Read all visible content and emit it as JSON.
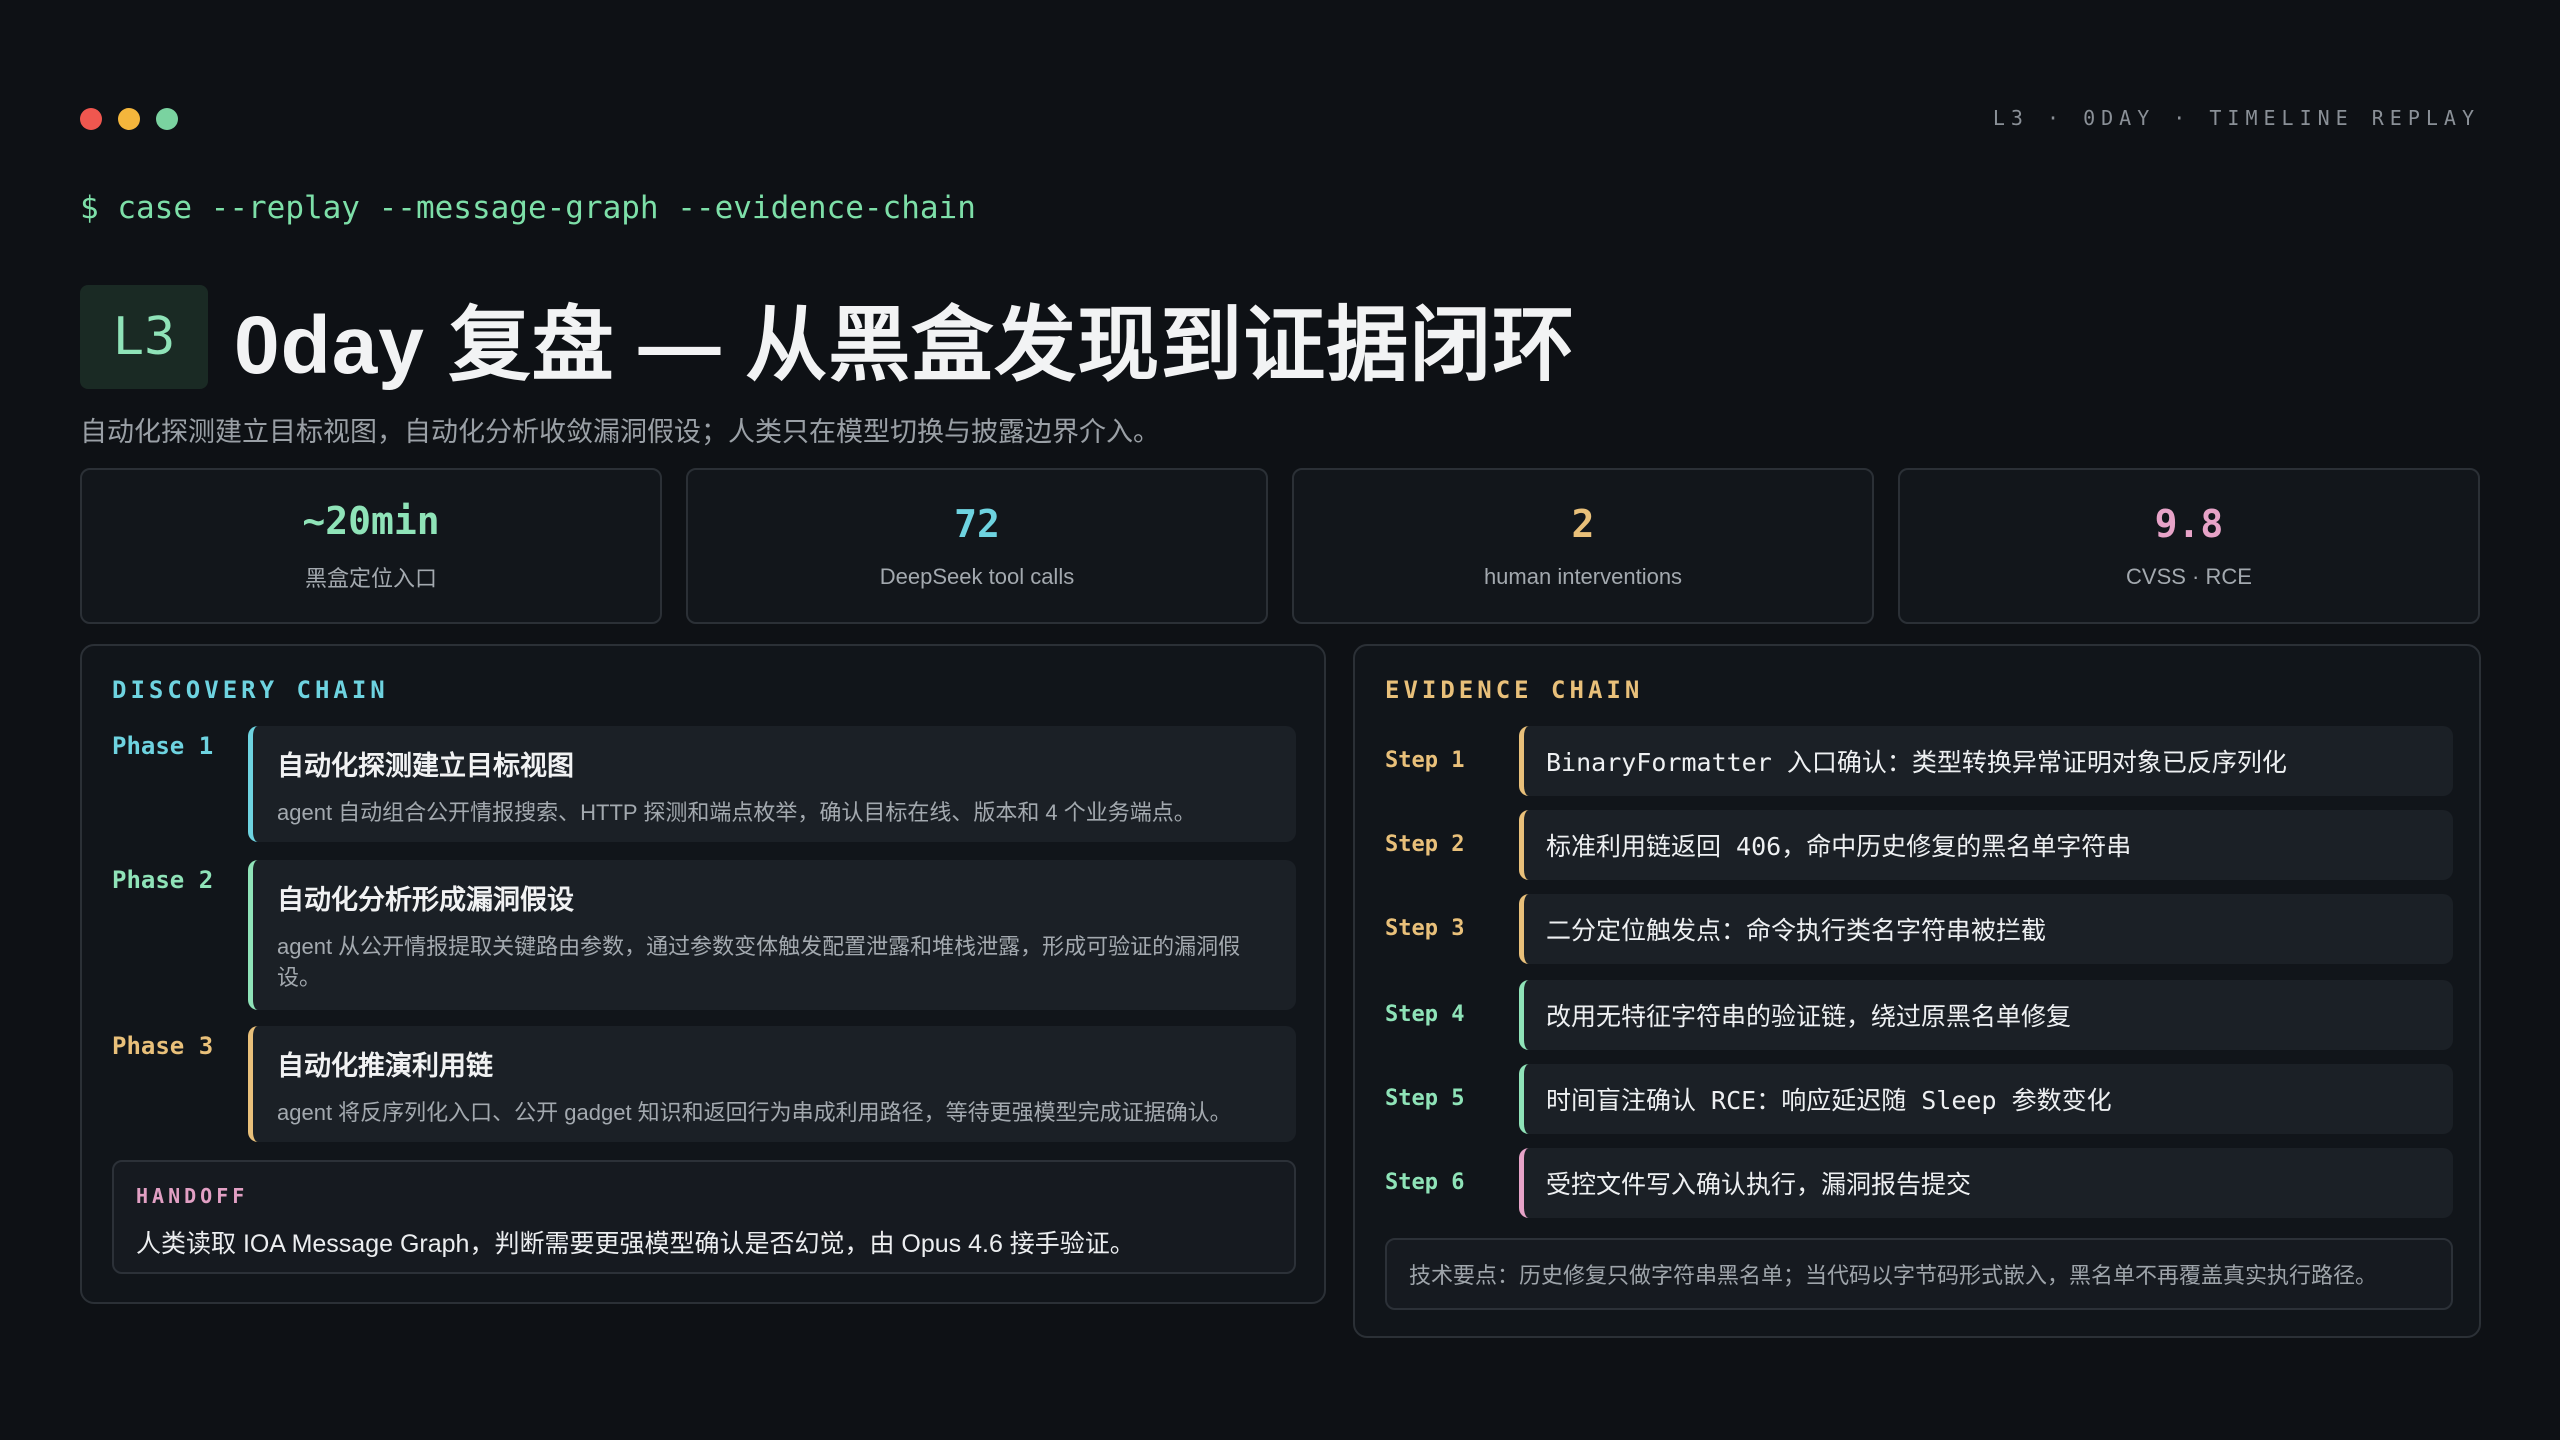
{
  "window": {
    "dots": [
      "#f0574f",
      "#f4b63c",
      "#7ad3a0"
    ],
    "top_label": "L3 · 0DAY · TIMELINE REPLAY"
  },
  "prompt": {
    "symbol": "$",
    "command": "case --replay --message-graph --evidence-chain"
  },
  "header": {
    "badge": "L3",
    "title": "0day 复盘 — 从黑盒发现到证据闭环",
    "subtitle": "自动化探测建立目标视图，自动化分析收敛漏洞假设；人类只在模型切换与披露边界介入。"
  },
  "stats": [
    {
      "value": "~20min",
      "label": "黑盒定位入口",
      "color": "#8fe3b8"
    },
    {
      "value": "72",
      "label": "DeepSeek tool calls",
      "color": "#6ed3e0"
    },
    {
      "value": "2",
      "label": "human interventions",
      "color": "#e9c07a"
    },
    {
      "value": "9.8",
      "label": "CVSS · RCE",
      "color": "#e7a3c8"
    }
  ],
  "discovery": {
    "heading": "DISCOVERY CHAIN",
    "heading_color": "#6ed3e0",
    "phases": [
      {
        "tag": "Phase 1",
        "title": "自动化探测建立目标视图",
        "desc": "agent 自动组合公开情报搜索、HTTP 探测和端点枚举，确认目标在线、版本和 4 个业务端点。",
        "color": "#6ed3e0"
      },
      {
        "tag": "Phase 2",
        "title": "自动化分析形成漏洞假设",
        "desc": "agent 从公开情报提取关键路由参数，通过参数变体触发配置泄露和堆栈泄露，形成可验证的漏洞假设。",
        "color": "#8fe3b8"
      },
      {
        "tag": "Phase 3",
        "title": "自动化推演利用链",
        "desc": "agent 将反序列化入口、公开 gadget 知识和返回行为串成利用路径，等待更强模型完成证据确认。",
        "color": "#e9c07a"
      }
    ],
    "handoff": {
      "label": "HANDOFF",
      "text": "人类读取 IOA Message Graph，判断需要更强模型确认是否幻觉，由 Opus 4.6 接手验证。"
    }
  },
  "evidence": {
    "heading": "EVIDENCE CHAIN",
    "heading_color": "#e9c07a",
    "steps": [
      {
        "tag": "Step 1",
        "text": "BinaryFormatter 入口确认：类型转换异常证明对象已反序列化",
        "tag_color": "#e9c07a",
        "color": "#e9c07a"
      },
      {
        "tag": "Step 2",
        "text": "标准利用链返回 406，命中历史修复的黑名单字符串",
        "tag_color": "#e9c07a",
        "color": "#e9c07a"
      },
      {
        "tag": "Step 3",
        "text": "二分定位触发点：命令执行类名字符串被拦截",
        "tag_color": "#e9c07a",
        "color": "#e9c07a"
      },
      {
        "tag": "Step 4",
        "text": "改用无特征字符串的验证链，绕过原黑名单修复",
        "tag_color": "#8fe3b8",
        "color": "#8fe3b8"
      },
      {
        "tag": "Step 5",
        "text": "时间盲注确认 RCE：响应延迟随 Sleep 参数变化",
        "tag_color": "#8fe3b8",
        "color": "#8fe3b8"
      },
      {
        "tag": "Step 6",
        "text": "受控文件写入确认执行，漏洞报告提交",
        "tag_color": "#8fe3b8",
        "color": "#e7a3c8"
      }
    ],
    "note": "技术要点：历史修复只做字符串黑名单；当代码以字节码形式嵌入，黑名单不再覆盖真实执行路径。"
  }
}
